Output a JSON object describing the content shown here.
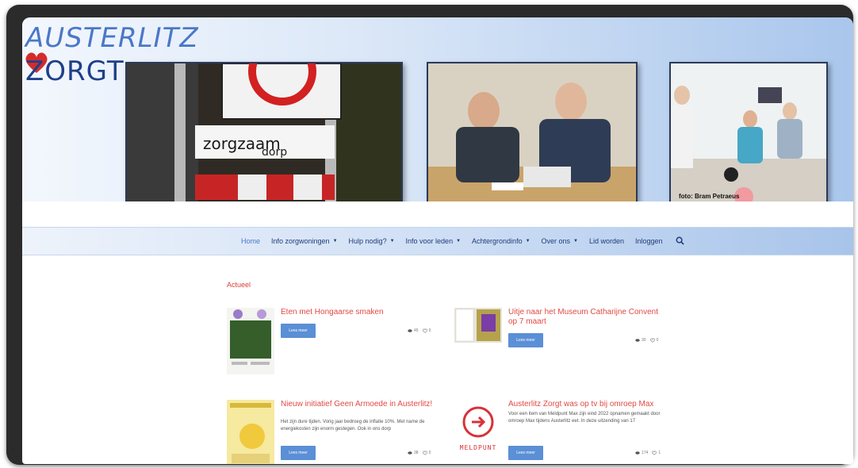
{
  "logo": {
    "line1": "AUSTERLITZ",
    "line2": "ZORGT"
  },
  "header": {
    "photo3_caption": "foto: Bram Petraeus"
  },
  "nav": {
    "items": [
      {
        "label": "Home",
        "caret": false
      },
      {
        "label": "Info zorgwoningen",
        "caret": true
      },
      {
        "label": "Hulp nodig?",
        "caret": true
      },
      {
        "label": "Info voor leden",
        "caret": true
      },
      {
        "label": "Achtergrondinfo",
        "caret": true
      },
      {
        "label": "Over ons",
        "caret": true
      },
      {
        "label": "Lid worden",
        "caret": false
      },
      {
        "label": "Inloggen",
        "caret": false
      }
    ],
    "caret_glyph": "▼"
  },
  "content": {
    "section_title": "Actueel",
    "posts": [
      {
        "title": "Eten met Hongaarse smaken",
        "excerpt": "",
        "button": "Lees meer",
        "views": "45",
        "likes": "0"
      },
      {
        "title": "Uitje naar het Museum Catharijne Convent op 7 maart",
        "excerpt": "",
        "button": "Lees meer",
        "views": "30",
        "likes": "0"
      },
      {
        "title": "Nieuw initiatief Geen Armoede in Austerlitz!",
        "excerpt": "Het zijn dure tijden. Vorig jaar bedroeg de inflatie 10%. Met name de energiekosten zijn enorm gestegen. Ook in ons dorp",
        "button": "Lees meer",
        "views": "38",
        "likes": "0"
      },
      {
        "title": "Austerlitz Zorgt was op tv bij omroep Max",
        "excerpt": "Voor een item van Meldpunt Max zijn eind 2022 opnamen gemaakt door omroep Max tijdens Austerlitz eet. In deze uitzending van 17",
        "button": "Lees meer",
        "views": "174",
        "likes": "1"
      }
    ],
    "meldpunt_label": "MELDPUNT"
  },
  "colors": {
    "accent": "#e04a44",
    "nav_text": "#1d3b7a",
    "button": "#5b8fd6"
  }
}
